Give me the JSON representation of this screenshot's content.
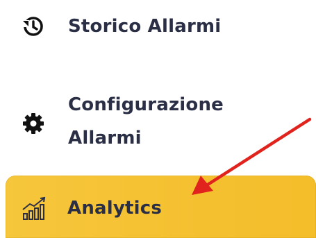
{
  "menu": {
    "items": [
      {
        "label": "Storico Allarmi",
        "icon": "history-icon"
      },
      {
        "label": "Configurazione Allarmi",
        "icon": "gear-icon"
      },
      {
        "label": "Analytics",
        "icon": "chart-growth-icon",
        "active": true
      }
    ]
  },
  "colors": {
    "text": "#2b2f45",
    "active_bg": "#f6c63b",
    "arrow": "#e1231d"
  }
}
